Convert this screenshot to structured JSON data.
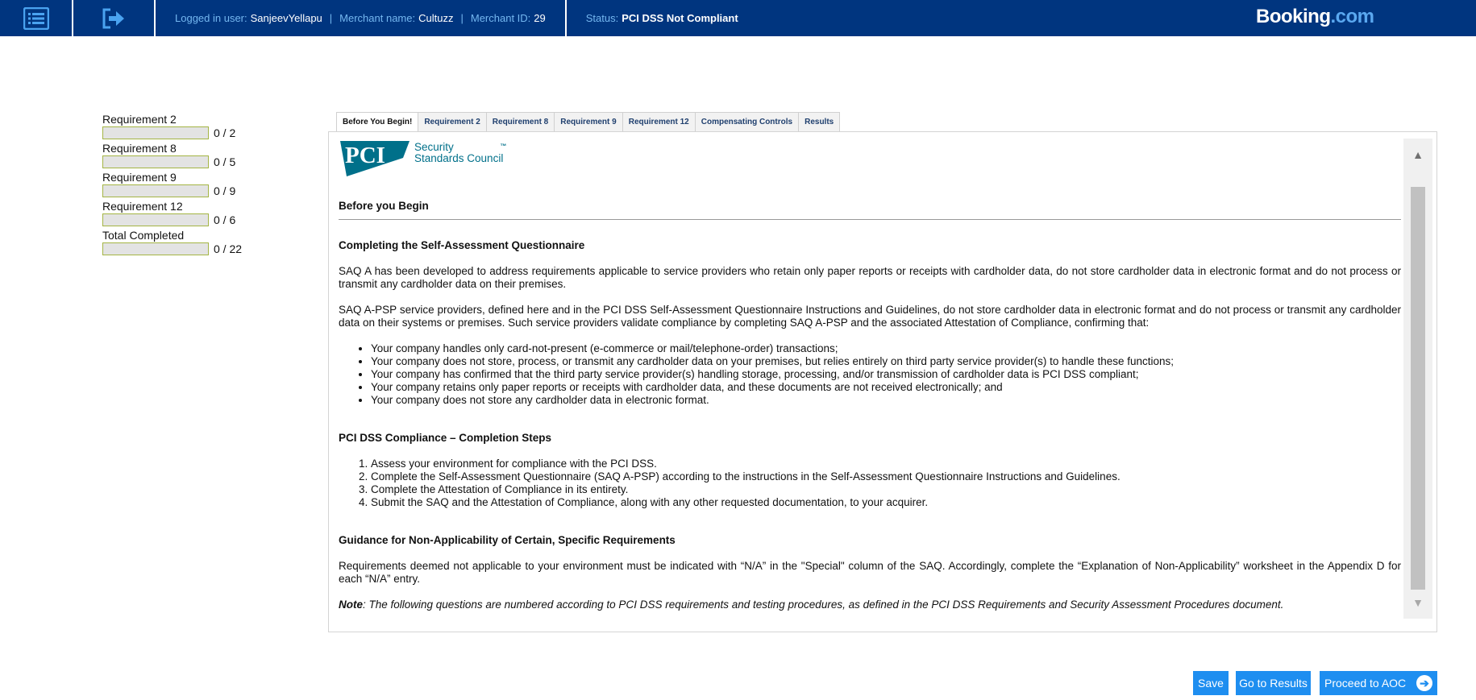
{
  "header": {
    "menu_icon": "list-menu-icon",
    "logout_icon": "logout-icon",
    "logged_in_label": "Logged in user:",
    "logged_in_value": "SanjeevYellapu",
    "merchant_name_label": "Merchant name:",
    "merchant_name_value": "Cultuzz",
    "merchant_id_label": "Merchant ID:",
    "merchant_id_value": "29",
    "separator": "|",
    "status_label": "Status:",
    "status_value": "PCI DSS Not Compliant",
    "brand_main": "Booking",
    "brand_suffix": ".com"
  },
  "progress": [
    {
      "label": "Requirement 2",
      "count": "0 / 2",
      "fraction": 0
    },
    {
      "label": "Requirement 8",
      "count": "0 / 5",
      "fraction": 0
    },
    {
      "label": "Requirement 9",
      "count": "0 / 9",
      "fraction": 0
    },
    {
      "label": "Requirement 12",
      "count": "0 / 6",
      "fraction": 0
    },
    {
      "label": "Total Completed",
      "count": "0 / 22",
      "fraction": 0
    }
  ],
  "tabs": [
    {
      "label": "Before You Begin!",
      "active": true
    },
    {
      "label": "Requirement 2"
    },
    {
      "label": "Requirement 8"
    },
    {
      "label": "Requirement 9"
    },
    {
      "label": "Requirement 12"
    },
    {
      "label": "Compensating Controls"
    },
    {
      "label": "Results"
    }
  ],
  "logo": {
    "mark": "PCI",
    "line1": "Security",
    "line2": "Standards Council",
    "tm": "™"
  },
  "content": {
    "title": "Before you Begin",
    "section1_title": "Completing the Self-Assessment Questionnaire",
    "para1": "SAQ A has been developed to address requirements applicable to service providers who retain only paper reports or receipts with cardholder data, do not store cardholder data in electronic format and do not process or transmit any cardholder data on their premises.",
    "para2": "SAQ A-PSP service providers, defined here and in the PCI DSS Self-Assessment Questionnaire Instructions and Guidelines, do not store cardholder data in electronic format and do not process or transmit any cardholder data on their systems or premises. Such service providers validate compliance by completing SAQ A-PSP and the associated Attestation of Compliance, confirming that:",
    "bullets": [
      "Your company handles only card-not-present (e-commerce or mail/telephone-order) transactions;",
      "Your company does not store, process, or transmit any cardholder data on your premises, but relies entirely on third party service provider(s) to handle these functions;",
      "Your company has confirmed that the third party service provider(s) handling storage, processing, and/or transmission of cardholder data is PCI DSS compliant;",
      "Your company retains only paper reports or receipts with cardholder data, and these documents are not received electronically; and",
      "Your company does not store any cardholder data in electronic format."
    ],
    "section2_title": "PCI DSS Compliance – Completion Steps",
    "steps": [
      "Assess your environment for compliance with the PCI DSS.",
      "Complete the Self-Assessment Questionnaire (SAQ A-PSP) according to the instructions in the Self-Assessment Questionnaire Instructions and Guidelines.",
      "Complete the Attestation of Compliance in its entirety.",
      "Submit the SAQ and the Attestation of Compliance, along with any other requested documentation, to your acquirer."
    ],
    "section3_title": "Guidance for Non-Applicability of Certain, Specific Requirements",
    "para3": "Requirements deemed not applicable to your environment must be indicated with “N/A” in the \"Special\" column of the SAQ. Accordingly, complete the “Explanation of Non-Applicability” worksheet in the Appendix D for each “N/A” entry.",
    "note_label": "Note",
    "note_text": ": The following questions are numbered according to PCI DSS requirements and testing procedures, as defined in the PCI DSS Requirements and Security Assessment Procedures document."
  },
  "scrollbar": {
    "up_icon": "arrow-up-icon",
    "up_glyph": "▲",
    "down_icon": "arrow-down-icon",
    "down_glyph": "▼"
  },
  "buttons": {
    "save": "Save",
    "results": "Go to Results",
    "aoc": "Proceed to AOC",
    "aoc_icon": "arrow-right-circle-icon",
    "aoc_glyph": "➔"
  },
  "colors": {
    "header_bg": "#00357f",
    "accent": "#1e8ef0",
    "pci_teal": "#00708a"
  }
}
